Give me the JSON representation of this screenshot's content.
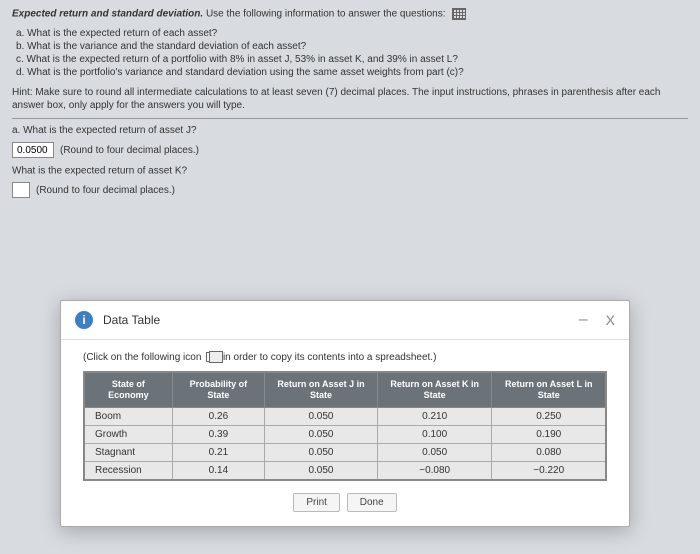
{
  "header": {
    "title_bold": "Expected return and standard deviation.",
    "title_rest": " Use the following information to answer the questions:"
  },
  "questions": {
    "a": "a.  What is the expected return of each asset?",
    "b": "b.  What is the variance and the standard deviation of each asset?",
    "c": "c.  What is the expected return of a portfolio with 8% in asset J, 53% in asset K, and 39% in asset L?",
    "d": "d.  What is the portfolio's variance and standard deviation using the same asset weights from part (c)?"
  },
  "hint": "Hint: Make sure to round all intermediate calculations to at least seven (7) decimal places. The input instructions, phrases in parenthesis after each answer box, only apply for the answers you will type.",
  "qa": {
    "q1": "a.  What is the expected return of asset J?",
    "a1_value": "0.0500",
    "a1_round": "(Round to four decimal places.)",
    "q2_pre": "What is the expected return of asset K?",
    "a2_round": "(Round to four decimal places.)"
  },
  "modal": {
    "title": "Data Table",
    "hint_pre": "(Click on the following icon ",
    "hint_post": " in order to copy its contents into a spreadsheet.)",
    "headers": {
      "h1": "State of Economy",
      "h2": "Probability of State",
      "h3": "Return on Asset J in State",
      "h4": "Return on Asset K in State",
      "h5": "Return on Asset L in State"
    },
    "buttons": {
      "print": "Print",
      "done": "Done"
    },
    "close": "X",
    "minimize": "–"
  },
  "chart_data": {
    "type": "table",
    "columns": [
      "State of Economy",
      "Probability of State",
      "Return on Asset J in State",
      "Return on Asset K in State",
      "Return on Asset L in State"
    ],
    "rows": [
      {
        "state": "Boom",
        "prob": "0.26",
        "j": "0.050",
        "k": "0.210",
        "l": "0.250"
      },
      {
        "state": "Growth",
        "prob": "0.39",
        "j": "0.050",
        "k": "0.100",
        "l": "0.190"
      },
      {
        "state": "Stagnant",
        "prob": "0.21",
        "j": "0.050",
        "k": "0.050",
        "l": "0.080"
      },
      {
        "state": "Recession",
        "prob": "0.14",
        "j": "0.050",
        "k": "−0.080",
        "l": "−0.220"
      }
    ]
  }
}
